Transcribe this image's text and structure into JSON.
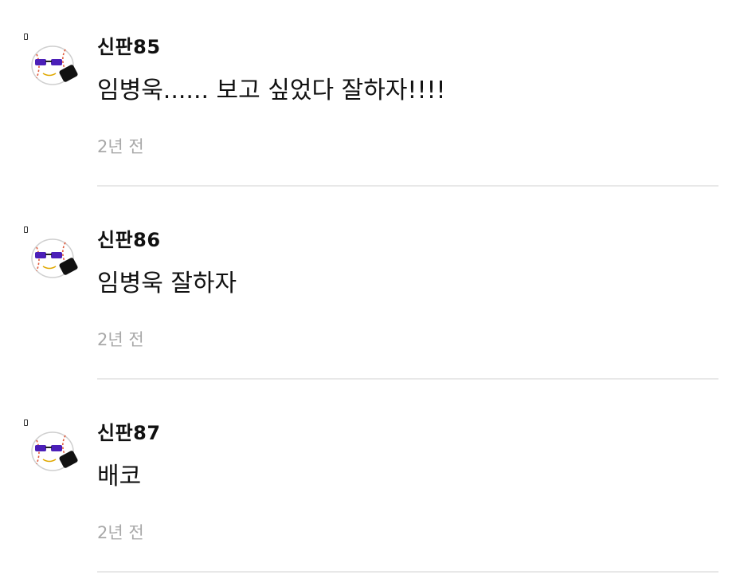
{
  "comments": [
    {
      "username": "신판85",
      "text": "임병욱...... 보고 싶었다 잘하자!!!!",
      "time": "2년 전",
      "avatar": "baseball-sunglasses-icon"
    },
    {
      "username": "신판86",
      "text": "임병욱 잘하자",
      "time": "2년 전",
      "avatar": "baseball-sunglasses-icon"
    },
    {
      "username": "신판87",
      "text": "배코",
      "time": "2년 전",
      "avatar": "baseball-sunglasses-icon"
    }
  ],
  "colors": {
    "time_text": "#a8a8a8",
    "divider": "#e8e8e8",
    "sunglasses": "#4b1fb8"
  }
}
